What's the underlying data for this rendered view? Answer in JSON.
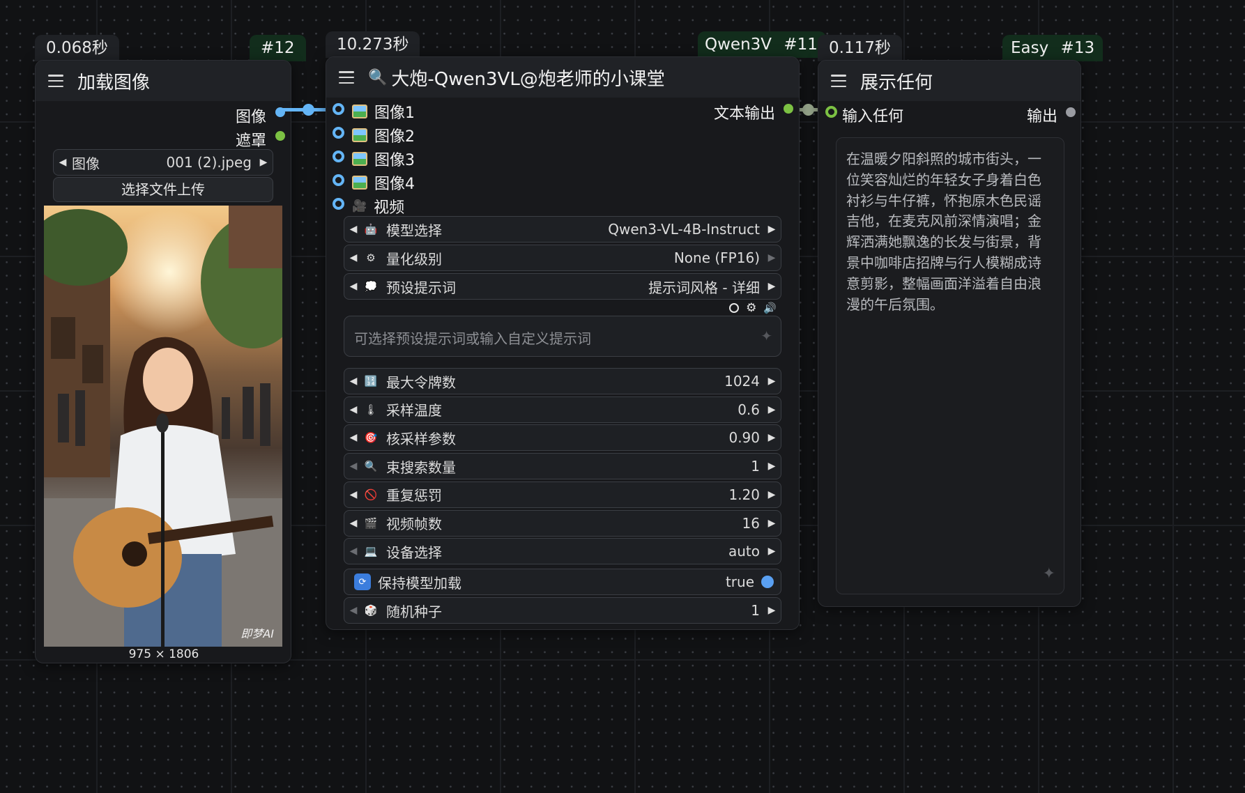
{
  "node12": {
    "time": "0.068秒",
    "id": "#12",
    "title": "加载图像",
    "outputs": [
      "图像",
      "遮罩"
    ],
    "image_widget": {
      "label": "图像",
      "value": "001 (2).jpeg"
    },
    "upload_label": "选择文件上传",
    "image_size": "975 × 1806",
    "watermark": "即梦AI"
  },
  "node11": {
    "time": "10.273秒",
    "tag": "Qwen3V",
    "id": "#11",
    "title": "大炮-Qwen3VL@炮老师的小课堂",
    "inputs": [
      "图像1",
      "图像2",
      "图像3",
      "图像4",
      "视频"
    ],
    "output": "文本输出",
    "widgets_top": [
      {
        "icon": "robot-icon",
        "glyph": "🤖",
        "label": "模型选择",
        "value": "Qwen3-VL-4B-Instruct"
      },
      {
        "icon": "gear-icon",
        "glyph": "⚙",
        "label": "量化级别",
        "value": "None (FP16)"
      },
      {
        "icon": "thought-bubble-icon",
        "glyph": "💭",
        "label": "预设提示词",
        "value": "提示词风格 - 详细"
      }
    ],
    "prompt_placeholder": "可选择预设提示词或输入自定义提示词",
    "widgets_bottom": [
      {
        "icon": "numbers-icon",
        "glyph": "🔢",
        "label": "最大令牌数",
        "value": "1024"
      },
      {
        "icon": "thermometer-icon",
        "glyph": "🌡",
        "label": "采样温度",
        "value": "0.6"
      },
      {
        "icon": "target-icon",
        "glyph": "🎯",
        "label": "核采样参数",
        "value": "0.90"
      },
      {
        "icon": "magnifier-icon",
        "glyph": "🔍",
        "label": "束搜索数量",
        "value": "1"
      },
      {
        "icon": "prohibited-icon",
        "glyph": "🚫",
        "label": "重复惩罚",
        "value": "1.20"
      },
      {
        "icon": "clapper-icon",
        "glyph": "🎬",
        "label": "视频帧数",
        "value": "16"
      },
      {
        "icon": "laptop-icon",
        "glyph": "💻",
        "label": "设备选择",
        "value": "auto"
      }
    ],
    "toggle": {
      "icon": "refresh-icon",
      "glyph": "🔄",
      "label": "保持模型加载",
      "value": "true"
    },
    "seed": {
      "icon": "dice-icon",
      "glyph": "🎲",
      "label": "随机种子",
      "value": "1"
    }
  },
  "node13": {
    "time": "0.117秒",
    "tag": "Easy",
    "id": "#13",
    "title": "展示任何",
    "input": "输入任何",
    "output": "输出",
    "text": "在温暖夕阳斜照的城市街头，一位笑容灿烂的年轻女子身着白色衬衫与牛仔裤，怀抱原木色民谣吉他，在麦克风前深情演唱；金辉洒满她飘逸的长发与街景，背景中咖啡店招牌与行人模糊成诗意剪影，整幅画面洋溢着自由浪漫的午后氛围。"
  },
  "colors": {
    "image_link": "#64b5f6",
    "string_link": "#7cc143",
    "node_id_bg": "#122d1c"
  }
}
